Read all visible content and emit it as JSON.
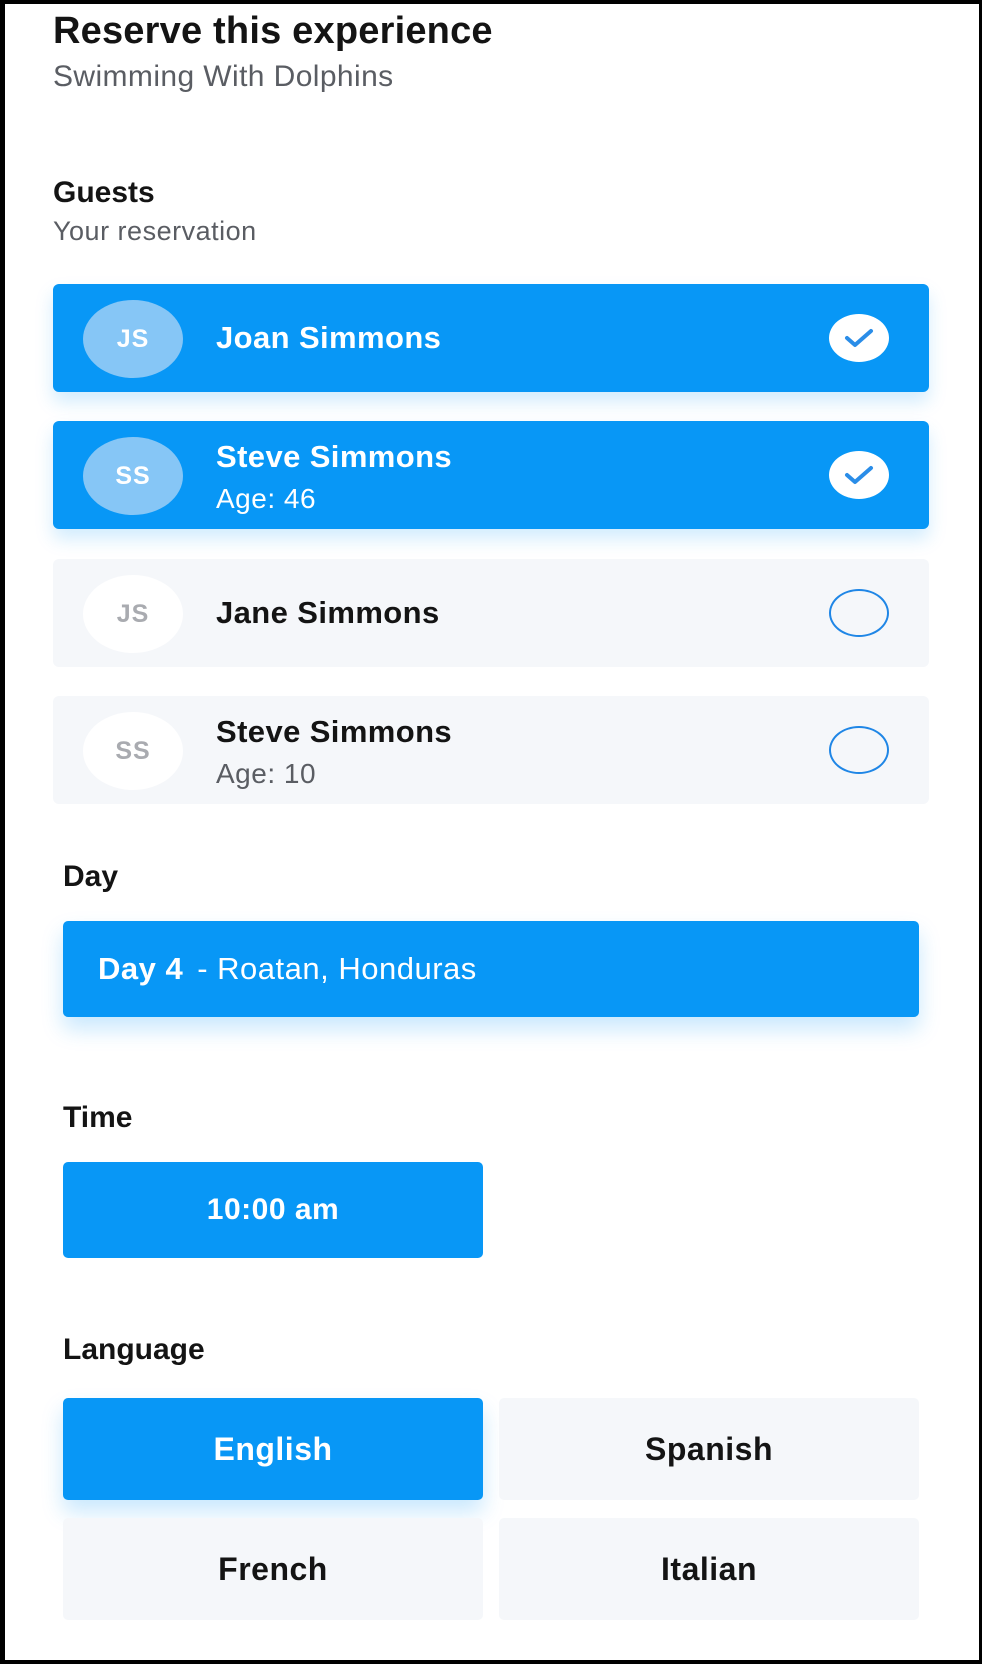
{
  "header": {
    "title": "Reserve this experience",
    "subtitle": "Swimming With Dolphins"
  },
  "guests_section": {
    "label": "Guests",
    "sublabel": "Your reservation",
    "items": [
      {
        "initials": "JS",
        "name": "Joan Simmons",
        "age": "",
        "selected": true
      },
      {
        "initials": "SS",
        "name": "Steve Simmons",
        "age": "Age: 46",
        "selected": true
      },
      {
        "initials": "JS",
        "name": "Jane Simmons",
        "age": "",
        "selected": false
      },
      {
        "initials": "SS",
        "name": "Steve Simmons",
        "age": "Age: 10",
        "selected": false
      }
    ]
  },
  "day_section": {
    "label": "Day",
    "day": "Day 4",
    "location": "- Roatan, Honduras"
  },
  "time_section": {
    "label": "Time",
    "value": "10:00 am"
  },
  "language_section": {
    "label": "Language",
    "options": [
      {
        "label": "English",
        "selected": true
      },
      {
        "label": "Spanish",
        "selected": false
      },
      {
        "label": "French",
        "selected": false
      },
      {
        "label": "Italian",
        "selected": false
      }
    ]
  },
  "colors": {
    "accent": "#0897f6",
    "avatar_selected": "#86c6f6",
    "unselected_bg": "#f5f7fa",
    "check_outline": "#1f86e6"
  }
}
